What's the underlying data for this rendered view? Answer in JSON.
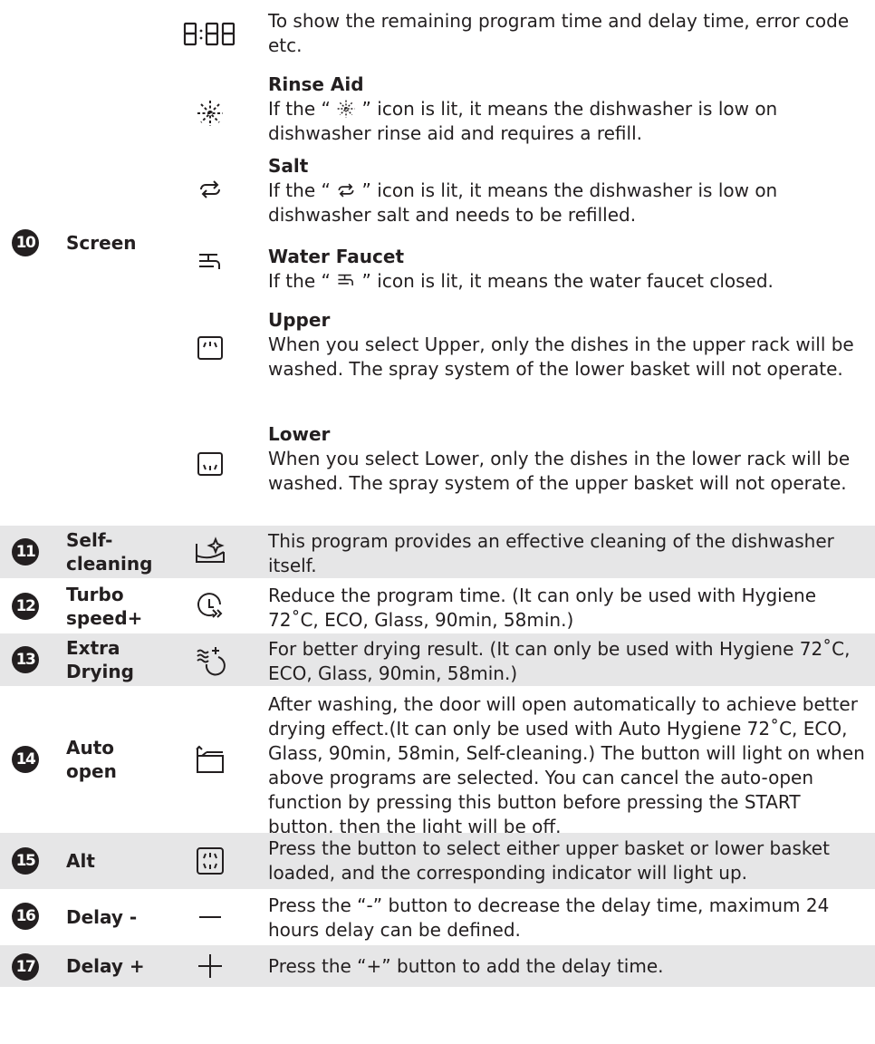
{
  "rows": [
    {
      "number": "10",
      "name": "Screen",
      "items": [
        {
          "icon": "digit-display-icon",
          "heading": "",
          "text": "To show the remaining program time and delay time, error code etc."
        },
        {
          "icon": "rinse-aid-icon",
          "heading": "Rinse Aid",
          "text_before": "If the “ ",
          "text_after": " ” icon is lit, it means the dishwasher is low on dishwasher rinse aid and requires a refill."
        },
        {
          "icon": "salt-icon",
          "heading": "Salt",
          "text_before": "If the “ ",
          "text_after": " ” icon is lit, it means the dishwasher is low on dishwasher salt and needs to be refilled."
        },
        {
          "icon": "water-faucet-icon",
          "heading": "Water Faucet",
          "text_before": "If the “ ",
          "text_after": " ” icon is lit, it means the water faucet closed."
        },
        {
          "icon": "upper-rack-icon",
          "heading": "Upper",
          "text": "When you select Upper, only the dishes in the upper rack will be washed. The spray system of the lower basket will not operate."
        },
        {
          "icon": "lower-rack-icon",
          "heading": "Lower",
          "text": "When you select Lower, only the dishes in the lower rack will be washed. The spray system of the upper basket will not operate."
        }
      ]
    },
    {
      "number": "11",
      "name": "Self-\ncleaning",
      "icon": "self-cleaning-icon",
      "text": "This program provides an effective cleaning of the dishwasher itself."
    },
    {
      "number": "12",
      "name": "Turbo\nspeed+",
      "icon": "turbo-speed-icon",
      "text": "Reduce the program time. (It can only be used with Hygiene 72˚C, ECO, Glass, 90min, 58min.)"
    },
    {
      "number": "13",
      "name": "Extra\nDrying",
      "icon": "extra-drying-icon",
      "text": "For better drying result. (It can only be used with Hygiene 72˚C, ECO, Glass, 90min, 58min.)"
    },
    {
      "number": "14",
      "name": "Auto\nopen",
      "icon": "auto-open-icon",
      "text": "After washing, the door will open automatically to achieve better drying effect.(It can only be used with Auto Hygiene 72˚C, ECO, Glass, 90min, 58min, Self-cleaning.) The button will light on when above programs are selected. You can cancel the auto-open function by pressing this button before pressing the START button, then the light will be off."
    },
    {
      "number": "15",
      "name": "Alt",
      "icon": "alt-basket-icon",
      "text": "Press the button to select either upper basket or lower basket loaded, and the corresponding indicator will light up."
    },
    {
      "number": "16",
      "name": "Delay -",
      "icon": "minus-icon",
      "text": "Press the “-” button to decrease the delay time, maximum 24 hours delay can be defined."
    },
    {
      "number": "17",
      "name": "Delay +",
      "icon": "plus-icon",
      "text": "Press the “+” button to add the delay time."
    }
  ]
}
